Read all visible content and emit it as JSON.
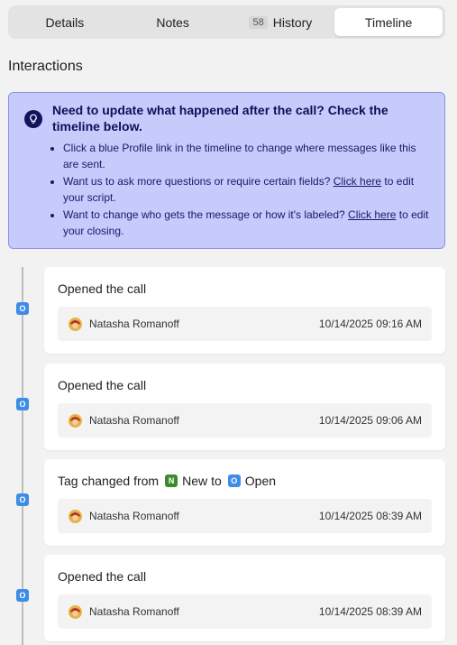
{
  "tabs": [
    {
      "label": "Details",
      "count": ""
    },
    {
      "label": "Notes",
      "count": ""
    },
    {
      "label": "History",
      "count": "58"
    },
    {
      "label": "Timeline",
      "count": ""
    }
  ],
  "section_title": "Interactions",
  "info": {
    "heading": "Need to update what happened after the call? Check the timeline below.",
    "bullet1": "Click a blue Profile link in the timeline to change where messages like this are sent.",
    "bullet2_pre": "Want us to ask more questions or require certain fields?",
    "bullet2_link": "Click here",
    "bullet2_post": "to edit your script.",
    "bullet3_pre": "Want to change who gets the message or how it's labeled?",
    "bullet3_link": "Click here",
    "bullet3_post": "to edit your closing."
  },
  "timeline": [
    {
      "marker": "O",
      "title": "Opened the call",
      "user": "Natasha Romanoff",
      "time": "10/14/2025 09:16 AM"
    },
    {
      "marker": "O",
      "title": "Opened the call",
      "user": "Natasha Romanoff",
      "time": "10/14/2025 09:06 AM"
    },
    {
      "marker": "O",
      "title_pre": "Tag changed from",
      "from_badge": "N",
      "from_label": "New",
      "to_word": "to",
      "to_badge": "O",
      "to_label": "Open",
      "user": "Natasha Romanoff",
      "time": "10/14/2025 08:39 AM"
    },
    {
      "marker": "O",
      "title": "Opened the call",
      "user": "Natasha Romanoff",
      "time": "10/14/2025 08:39 AM"
    }
  ],
  "colors": {
    "accent_blue": "#3d8ce6",
    "new_green": "#3c8a2e",
    "info_bg": "#c6cbfb",
    "info_text": "#12125e"
  }
}
